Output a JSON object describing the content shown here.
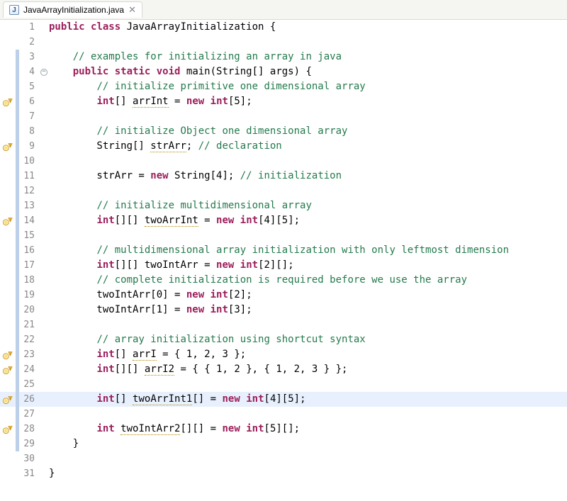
{
  "tab": {
    "icon_letter": "J",
    "title": "JavaArrayInitialization.java",
    "close_glyph": "✕"
  },
  "fold_minus_glyph": "−",
  "lines": [
    {
      "n": 1,
      "warn": false,
      "cov": false,
      "fold": "",
      "hl": false,
      "tokens": [
        [
          "kw",
          "public"
        ],
        [
          "",
          " "
        ],
        [
          "kw",
          "class"
        ],
        [
          "",
          " JavaArrayInitialization {"
        ]
      ]
    },
    {
      "n": 2,
      "warn": false,
      "cov": false,
      "fold": "",
      "hl": false,
      "tokens": [
        [
          "",
          ""
        ]
      ]
    },
    {
      "n": 3,
      "warn": false,
      "cov": true,
      "fold": "",
      "hl": false,
      "tokens": [
        [
          "",
          "    "
        ],
        [
          "cm",
          "// examples for initializing an array in java"
        ]
      ]
    },
    {
      "n": 4,
      "warn": false,
      "cov": true,
      "fold": "m",
      "hl": false,
      "tokens": [
        [
          "",
          "    "
        ],
        [
          "kw",
          "public"
        ],
        [
          "",
          " "
        ],
        [
          "kw",
          "static"
        ],
        [
          "",
          " "
        ],
        [
          "kw",
          "void"
        ],
        [
          "",
          " main(String[] args) {"
        ]
      ]
    },
    {
      "n": 5,
      "warn": false,
      "cov": true,
      "fold": "",
      "hl": false,
      "tokens": [
        [
          "",
          "        "
        ],
        [
          "cm",
          "// initialize primitive one dimensional array"
        ]
      ]
    },
    {
      "n": 6,
      "warn": true,
      "cov": true,
      "fold": "",
      "hl": false,
      "tokens": [
        [
          "",
          "        "
        ],
        [
          "kw",
          "int"
        ],
        [
          "",
          "[] "
        ],
        [
          "warned",
          "arrInt"
        ],
        [
          "",
          " = "
        ],
        [
          "kw",
          "new"
        ],
        [
          "",
          " "
        ],
        [
          "kw",
          "int"
        ],
        [
          "",
          "[5];"
        ]
      ]
    },
    {
      "n": 7,
      "warn": false,
      "cov": true,
      "fold": "",
      "hl": false,
      "tokens": [
        [
          "",
          ""
        ]
      ]
    },
    {
      "n": 8,
      "warn": false,
      "cov": true,
      "fold": "",
      "hl": false,
      "tokens": [
        [
          "",
          "        "
        ],
        [
          "cm",
          "// initialize Object one dimensional array"
        ]
      ]
    },
    {
      "n": 9,
      "warn": true,
      "cov": true,
      "fold": "",
      "hl": false,
      "tokens": [
        [
          "",
          "        String[] "
        ],
        [
          "warned",
          "strArr"
        ],
        [
          "",
          "; "
        ],
        [
          "cm",
          "// declaration"
        ]
      ]
    },
    {
      "n": 10,
      "warn": false,
      "cov": true,
      "fold": "",
      "hl": false,
      "tokens": [
        [
          "",
          ""
        ]
      ]
    },
    {
      "n": 11,
      "warn": false,
      "cov": true,
      "fold": "",
      "hl": false,
      "tokens": [
        [
          "",
          "        strArr = "
        ],
        [
          "kw",
          "new"
        ],
        [
          "",
          " String[4]; "
        ],
        [
          "cm",
          "// initialization"
        ]
      ]
    },
    {
      "n": 12,
      "warn": false,
      "cov": true,
      "fold": "",
      "hl": false,
      "tokens": [
        [
          "",
          ""
        ]
      ]
    },
    {
      "n": 13,
      "warn": false,
      "cov": true,
      "fold": "",
      "hl": false,
      "tokens": [
        [
          "",
          "        "
        ],
        [
          "cm",
          "// initialize multidimensional array"
        ]
      ]
    },
    {
      "n": 14,
      "warn": true,
      "cov": true,
      "fold": "",
      "hl": false,
      "tokens": [
        [
          "",
          "        "
        ],
        [
          "kw",
          "int"
        ],
        [
          "",
          "[][] "
        ],
        [
          "warned",
          "twoArrInt"
        ],
        [
          "",
          " = "
        ],
        [
          "kw",
          "new"
        ],
        [
          "",
          " "
        ],
        [
          "kw",
          "int"
        ],
        [
          "",
          "[4][5];"
        ]
      ]
    },
    {
      "n": 15,
      "warn": false,
      "cov": true,
      "fold": "",
      "hl": false,
      "tokens": [
        [
          "",
          ""
        ]
      ]
    },
    {
      "n": 16,
      "warn": false,
      "cov": true,
      "fold": "",
      "hl": false,
      "tokens": [
        [
          "",
          "        "
        ],
        [
          "cm",
          "// multidimensional array initialization with only leftmost dimension"
        ]
      ]
    },
    {
      "n": 17,
      "warn": false,
      "cov": true,
      "fold": "",
      "hl": false,
      "tokens": [
        [
          "",
          "        "
        ],
        [
          "kw",
          "int"
        ],
        [
          "",
          "[][] twoIntArr = "
        ],
        [
          "kw",
          "new"
        ],
        [
          "",
          " "
        ],
        [
          "kw",
          "int"
        ],
        [
          "",
          "[2][];"
        ]
      ]
    },
    {
      "n": 18,
      "warn": false,
      "cov": true,
      "fold": "",
      "hl": false,
      "tokens": [
        [
          "",
          "        "
        ],
        [
          "cm",
          "// complete initialization is required before we use the array"
        ]
      ]
    },
    {
      "n": 19,
      "warn": false,
      "cov": true,
      "fold": "",
      "hl": false,
      "tokens": [
        [
          "",
          "        twoIntArr[0] = "
        ],
        [
          "kw",
          "new"
        ],
        [
          "",
          " "
        ],
        [
          "kw",
          "int"
        ],
        [
          "",
          "[2];"
        ]
      ]
    },
    {
      "n": 20,
      "warn": false,
      "cov": true,
      "fold": "",
      "hl": false,
      "tokens": [
        [
          "",
          "        twoIntArr[1] = "
        ],
        [
          "kw",
          "new"
        ],
        [
          "",
          " "
        ],
        [
          "kw",
          "int"
        ],
        [
          "",
          "[3];"
        ]
      ]
    },
    {
      "n": 21,
      "warn": false,
      "cov": true,
      "fold": "",
      "hl": false,
      "tokens": [
        [
          "",
          ""
        ]
      ]
    },
    {
      "n": 22,
      "warn": false,
      "cov": true,
      "fold": "",
      "hl": false,
      "tokens": [
        [
          "",
          "        "
        ],
        [
          "cm",
          "// array initialization using shortcut syntax"
        ]
      ]
    },
    {
      "n": 23,
      "warn": true,
      "cov": true,
      "fold": "",
      "hl": false,
      "tokens": [
        [
          "",
          "        "
        ],
        [
          "kw",
          "int"
        ],
        [
          "",
          "[] "
        ],
        [
          "warned",
          "arrI"
        ],
        [
          "",
          " = { 1, 2, 3 };"
        ]
      ]
    },
    {
      "n": 24,
      "warn": true,
      "cov": true,
      "fold": "",
      "hl": false,
      "tokens": [
        [
          "",
          "        "
        ],
        [
          "kw",
          "int"
        ],
        [
          "",
          "[][] "
        ],
        [
          "warned",
          "arrI2"
        ],
        [
          "",
          " = { { 1, 2 }, { 1, 2, 3 } };"
        ]
      ]
    },
    {
      "n": 25,
      "warn": false,
      "cov": true,
      "fold": "",
      "hl": false,
      "tokens": [
        [
          "",
          ""
        ]
      ]
    },
    {
      "n": 26,
      "warn": true,
      "cov": true,
      "fold": "",
      "hl": true,
      "tokens": [
        [
          "",
          "        "
        ],
        [
          "kw",
          "int"
        ],
        [
          "",
          "[] "
        ],
        [
          "warned",
          "twoArrInt1"
        ],
        [
          "",
          "[] = "
        ],
        [
          "kw",
          "new"
        ],
        [
          "",
          " "
        ],
        [
          "kw",
          "int"
        ],
        [
          "",
          "[4][5];"
        ]
      ]
    },
    {
      "n": 27,
      "warn": false,
      "cov": true,
      "fold": "",
      "hl": false,
      "tokens": [
        [
          "",
          ""
        ]
      ]
    },
    {
      "n": 28,
      "warn": true,
      "cov": true,
      "fold": "",
      "hl": false,
      "tokens": [
        [
          "",
          "        "
        ],
        [
          "kw",
          "int"
        ],
        [
          "",
          " "
        ],
        [
          "warned",
          "twoIntArr2"
        ],
        [
          "",
          "[][] = "
        ],
        [
          "kw",
          "new"
        ],
        [
          "",
          " "
        ],
        [
          "kw",
          "int"
        ],
        [
          "",
          "[5][];"
        ]
      ]
    },
    {
      "n": 29,
      "warn": false,
      "cov": true,
      "fold": "",
      "hl": false,
      "tokens": [
        [
          "",
          "    }"
        ]
      ]
    },
    {
      "n": 30,
      "warn": false,
      "cov": false,
      "fold": "",
      "hl": false,
      "tokens": [
        [
          "",
          ""
        ]
      ]
    },
    {
      "n": 31,
      "warn": false,
      "cov": false,
      "fold": "",
      "hl": false,
      "tokens": [
        [
          "",
          "}"
        ]
      ]
    }
  ]
}
